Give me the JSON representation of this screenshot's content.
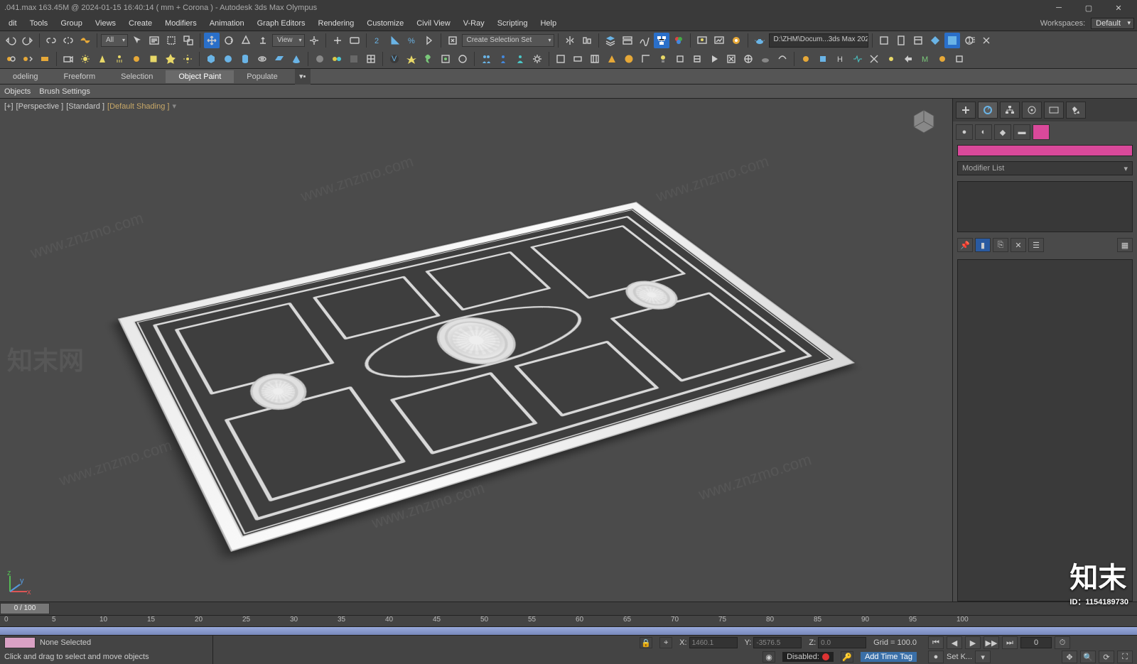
{
  "title": ".041.max  163.45M @ 2024-01-15 16:40:14  ( mm + Corona ) - Autodesk 3ds Max Olympus",
  "menu": [
    "dit",
    "Tools",
    "Group",
    "Views",
    "Create",
    "Modifiers",
    "Animation",
    "Graph Editors",
    "Rendering",
    "Customize",
    "Civil View",
    "V-Ray",
    "Scripting",
    "Help"
  ],
  "workspaces_label": "Workspaces:",
  "workspace": "Default",
  "toolbar": {
    "all": "All",
    "view": "View",
    "sel_set": "Create Selection Set",
    "path": "D:\\ZHM\\Docum...3ds Max 202",
    "badge": "15"
  },
  "ribbon": {
    "tabs": [
      "odeling",
      "Freeform",
      "Selection",
      "Object Paint",
      "Populate"
    ],
    "active": 3,
    "sub": [
      "Objects",
      "Brush Settings"
    ]
  },
  "viewport": {
    "labels": [
      "[+]",
      "[Perspective ]",
      "[Standard ]",
      "[Default Shading ]"
    ]
  },
  "cmdpanel": {
    "modifier_list": "Modifier List"
  },
  "timeline": {
    "frame": "0 / 100",
    "ticks": [
      "0",
      "5",
      "10",
      "15",
      "20",
      "25",
      "30",
      "35",
      "40",
      "45",
      "50",
      "55",
      "60",
      "65",
      "70",
      "75",
      "80",
      "85",
      "90",
      "95",
      "100"
    ]
  },
  "status": {
    "selection": "None Selected",
    "prompt": "Click and drag to select and move objects",
    "x_label": "X:",
    "x": "1460.1",
    "y_label": "Y:",
    "y": "-3576.5",
    "z_label": "Z:",
    "z": "0.0",
    "grid": "Grid = 100.0",
    "disabled": "Disabled:",
    "autokey": "",
    "addtag": "Add Time Tag",
    "setk": "Set K...",
    "frame": "0"
  },
  "overlay": {
    "brand": "知末",
    "id": "ID：1154189730"
  },
  "watermarks": [
    "www.znzmo.com",
    "www.znzmo.com",
    "www.znzmo.com",
    "www.znzmo.com",
    "www.znzmo.com",
    "www.znzmo.com"
  ]
}
